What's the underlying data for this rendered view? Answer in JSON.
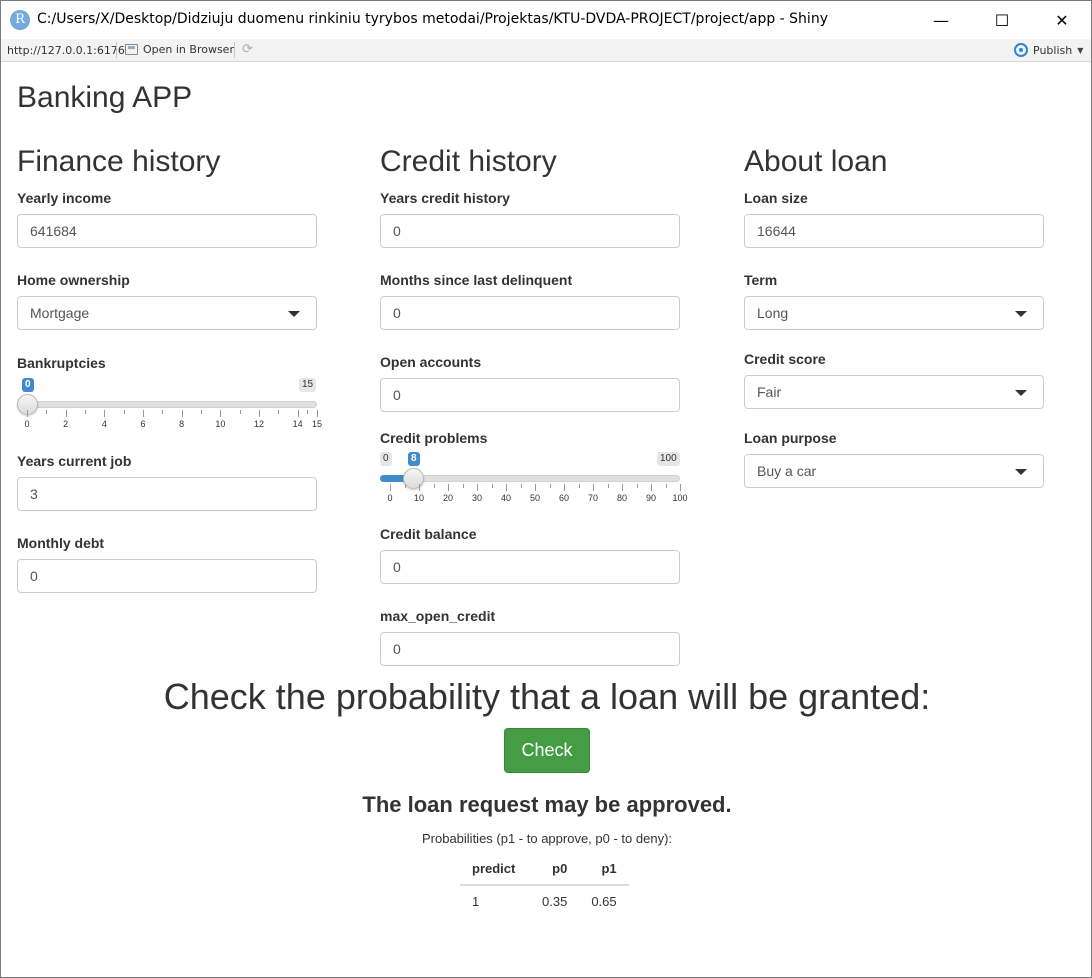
{
  "window": {
    "title": "C:/Users/X/Desktop/Didziuju duomenu rinkiniu tyrybos metodai/Projektas/KTU-DVDA-PROJECT/project/app - Shiny",
    "app_icon": "R",
    "minimize": "—",
    "maximize": "☐",
    "close": "✕"
  },
  "toolbar": {
    "url": "http://127.0.0.1:6176",
    "open_in_browser": "Open in Browser",
    "publish": "Publish"
  },
  "app": {
    "title": "Banking APP"
  },
  "finance": {
    "heading": "Finance history",
    "yearly_income_label": "Yearly income",
    "yearly_income_value": "641684",
    "home_ownership_label": "Home ownership",
    "home_ownership_value": "Mortgage",
    "bankruptcies_label": "Bankruptcies",
    "bankruptcies": {
      "min": "0",
      "max": "15",
      "value": "0",
      "ticks": [
        "0",
        "2",
        "4",
        "6",
        "8",
        "10",
        "12",
        "14",
        "15"
      ]
    },
    "years_current_job_label": "Years current job",
    "years_current_job_value": "3",
    "monthly_debt_label": "Monthly debt",
    "monthly_debt_value": "0"
  },
  "credit": {
    "heading": "Credit history",
    "years_credit_history_label": "Years credit history",
    "years_credit_history_value": "0",
    "months_since_delinquent_label": "Months since last delinquent",
    "months_since_delinquent_value": "0",
    "open_accounts_label": "Open accounts",
    "open_accounts_value": "0",
    "credit_problems_label": "Credit problems",
    "credit_problems": {
      "min": "0",
      "max": "100",
      "value": "8",
      "ticks": [
        "0",
        "10",
        "20",
        "30",
        "40",
        "50",
        "60",
        "70",
        "80",
        "90",
        "100"
      ]
    },
    "credit_balance_label": "Credit balance",
    "credit_balance_value": "0",
    "max_open_credit_label": "max_open_credit",
    "max_open_credit_value": "0"
  },
  "loan": {
    "heading": "About loan",
    "loan_size_label": "Loan size",
    "loan_size_value": "16644",
    "term_label": "Term",
    "term_value": "Long",
    "credit_score_label": "Credit score",
    "credit_score_value": "Fair",
    "loan_purpose_label": "Loan purpose",
    "loan_purpose_value": "Buy a car"
  },
  "check": {
    "heading": "Check the probability that a loan will be granted:",
    "button": "Check",
    "result": "The loan request may be approved.",
    "caption": "Probabilities (p1 - to approve, p0 - to deny):",
    "table": {
      "headers": [
        "predict",
        "p0",
        "p1"
      ],
      "rows": [
        [
          "1",
          "0.35",
          "0.65"
        ]
      ]
    }
  },
  "colors": {
    "accent": "#428bca",
    "check_button": "#449d44"
  }
}
